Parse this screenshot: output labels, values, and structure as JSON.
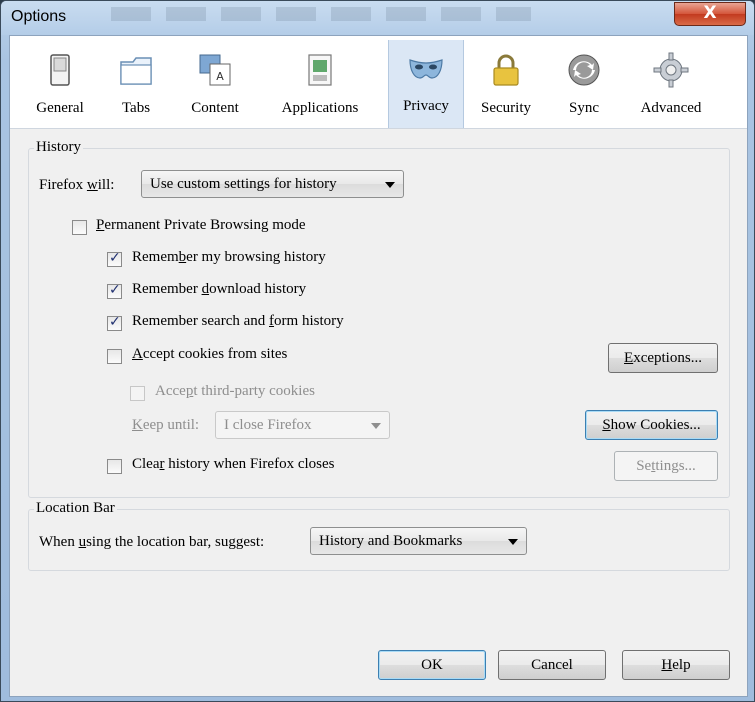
{
  "window": {
    "title": "Options",
    "close_glyph": "X"
  },
  "tabs": [
    {
      "label": "General",
      "icon": "switch-icon"
    },
    {
      "label": "Tabs",
      "icon": "tabs-icon"
    },
    {
      "label": "Content",
      "icon": "content-icon"
    },
    {
      "label": "Applications",
      "icon": "applications-icon"
    },
    {
      "label": "Privacy",
      "icon": "mask-icon",
      "selected": true
    },
    {
      "label": "Security",
      "icon": "padlock-icon"
    },
    {
      "label": "Sync",
      "icon": "sync-icon"
    },
    {
      "label": "Advanced",
      "icon": "gear-icon"
    }
  ],
  "history": {
    "legend": "History",
    "firefox_will_pre": "Firefox ",
    "firefox_will_u": "w",
    "firefox_will_post": "ill:",
    "mode_value": "Use custom settings for history",
    "permanent_private": {
      "u": "P",
      "rest": "ermanent Private Browsing mode",
      "checked": false
    },
    "browsing_history": {
      "pre": "Remem",
      "u": "b",
      "rest": "er my browsing history",
      "checked": true
    },
    "download_history": {
      "pre": "Remember ",
      "u": "d",
      "rest": "ownload history",
      "checked": true
    },
    "search_form_history": {
      "pre": "Remember search and ",
      "u": "f",
      "rest": "orm history",
      "checked": true
    },
    "accept_cookies": {
      "u": "A",
      "rest": "ccept cookies from sites",
      "checked": false
    },
    "third_party": {
      "pre": "Acce",
      "u": "p",
      "rest": "t third-party cookies",
      "checked": false
    },
    "keep_until_u": "K",
    "keep_until_rest": "eep until:",
    "keep_until_value": "I close Firefox",
    "clear_history": {
      "pre": "Clea",
      "u": "r",
      "rest": " history when Firefox closes",
      "checked": false
    },
    "exceptions_u": "E",
    "exceptions_rest": "xceptions...",
    "show_cookies_u": "S",
    "show_cookies_rest": "how Cookies...",
    "settings_pre": "Se",
    "settings_u": "t",
    "settings_rest": "tings..."
  },
  "location_bar": {
    "legend": "Location Bar",
    "prompt_pre": "When ",
    "prompt_u": "u",
    "prompt_rest": "sing the location bar, suggest:",
    "suggest_value": "History and Bookmarks"
  },
  "footer": {
    "ok": "OK",
    "cancel": "Cancel",
    "help_u": "H",
    "help_rest": "elp"
  }
}
